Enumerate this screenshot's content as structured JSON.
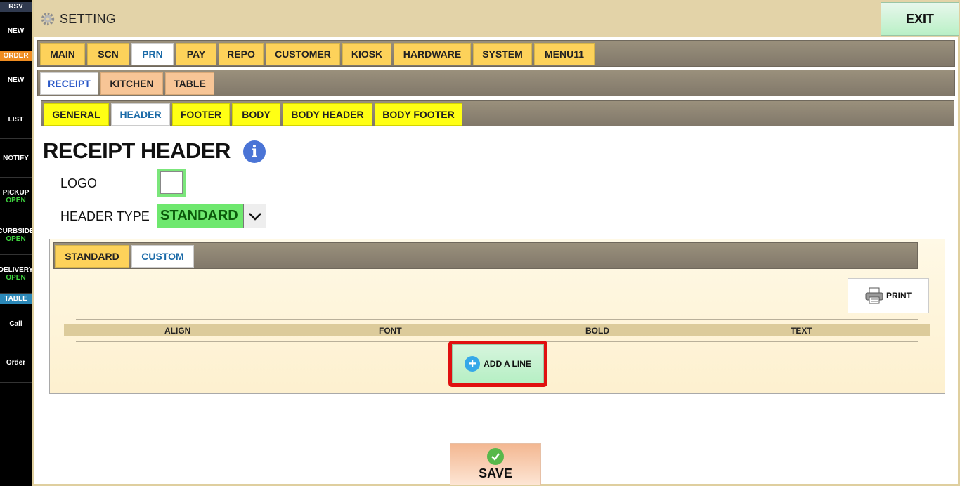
{
  "sidebar": {
    "rsv_header": "RSV",
    "order_header": "ORDER",
    "table_header": "TABLE",
    "items": {
      "rsv_new": "NEW",
      "order_new": "NEW",
      "list": "LIST",
      "notify": "NOTIFY",
      "pickup": "PICKUP",
      "pickup_status": "OPEN",
      "curbside": "CURBSIDE",
      "curbside_status": "OPEN",
      "delivery": "DELIVERY",
      "delivery_status": "OPEN",
      "call": "Call",
      "order": "Order"
    },
    "colors": {
      "rsv": "#303a4f",
      "order": "#ef8c20",
      "table": "#2b88b8",
      "status": "#3fd33f"
    }
  },
  "header": {
    "title": "SETTING",
    "exit_label": "EXIT"
  },
  "tabs_main": {
    "items": [
      "MAIN",
      "SCN",
      "PRN",
      "PAY",
      "REPO",
      "CUSTOMER",
      "KIOSK",
      "HARDWARE",
      "SYSTEM",
      "MENU11"
    ],
    "active": "PRN"
  },
  "tabs_prn": {
    "items": [
      "RECEIPT",
      "KITCHEN",
      "TABLE"
    ],
    "active": "RECEIPT"
  },
  "tabs_receipt": {
    "items": [
      "GENERAL",
      "HEADER",
      "FOOTER",
      "BODY",
      "BODY HEADER",
      "BODY FOOTER"
    ],
    "active": "HEADER"
  },
  "content": {
    "page_title": "RECEIPT HEADER",
    "info_icon": "info-icon",
    "logo_label": "LOGO",
    "header_type_label": "HEADER TYPE",
    "header_type_value": "STANDARD"
  },
  "header_panel": {
    "tabs": [
      "STANDARD",
      "CUSTOM"
    ],
    "active": "CUSTOM",
    "print_label": "PRINT",
    "columns": [
      "ALIGN",
      "FONT",
      "BOLD",
      "TEXT"
    ],
    "add_line_label": "ADD A LINE"
  },
  "footer": {
    "save_label": "SAVE"
  },
  "colors": {
    "topbar": "#e3d3a8",
    "tab_yellow": "#fdd25a",
    "tab_peach": "#f7c596",
    "tab_bright_yellow": "#ffff14",
    "highlight_red": "#e01010",
    "green": "#6ee86e"
  }
}
